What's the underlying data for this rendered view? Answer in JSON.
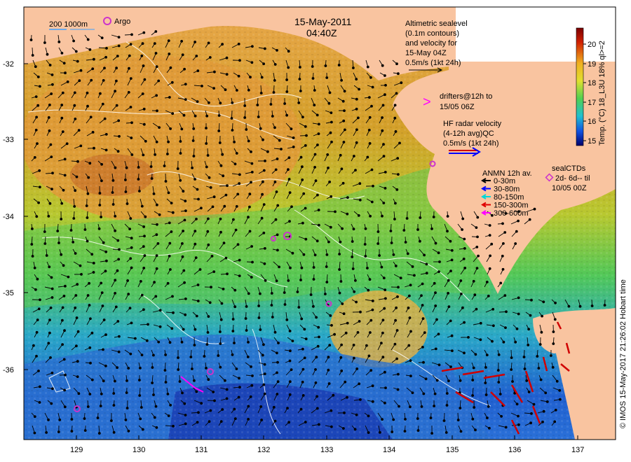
{
  "title": {
    "date": "15-May-2011",
    "time": "04:40Z"
  },
  "legend_top_left": {
    "isobaths": "200  1000m",
    "argo": "Argo"
  },
  "altimetry_note": {
    "line1": "Altimetric sealevel",
    "line2": "(0.1m contours)",
    "line3": "and velocity for",
    "line4": "15-May 04Z",
    "line5": "0.5m/s (1kt 24h)"
  },
  "drifters_note": {
    "symbol": ">",
    "line1": "drifters@12h to",
    "line2": "15/05 06Z"
  },
  "hf_radar_note": {
    "line1": "HF radar velocity",
    "line2": "(4-12h avg)QC",
    "line3": "0.5m/s (1kt 24h)"
  },
  "anmn_legend": {
    "title": "ANMN 12h av.",
    "items": [
      {
        "label": "0-30m",
        "color": "#000000"
      },
      {
        "label": "30-80m",
        "color": "#0000ff"
      },
      {
        "label": "80-150m",
        "color": "#00d8d8"
      },
      {
        "label": "150-300m",
        "color": "#e00000"
      },
      {
        "label": "300-600m",
        "color": "#ff00ff"
      }
    ]
  },
  "seal_legend": {
    "line1": "sealCTDs",
    "line2": "2d- 6d-- til",
    "line3": "10/05 00Z"
  },
  "colorbar": {
    "ticks": [
      "20",
      "19",
      "18",
      "17",
      "16",
      "15"
    ],
    "label": "Temp. (°C) 18_L3U 18% ql>=2"
  },
  "credit": "© IMOS 15-May-2017 21:26:02 Hobart time",
  "axes": {
    "y_ticks": [
      "-32",
      "-33",
      "-34",
      "-35",
      "-36"
    ],
    "x_ticks": [
      "129",
      "130",
      "131",
      "132",
      "133",
      "134",
      "135",
      "136",
      "137"
    ]
  },
  "colors": {
    "land": "#f9c4a0",
    "sea_warm": "#e8a030",
    "sea_mid": "#7ccf4a",
    "sea_cool": "#2a8ed8",
    "sea_cold": "#1030b0"
  }
}
